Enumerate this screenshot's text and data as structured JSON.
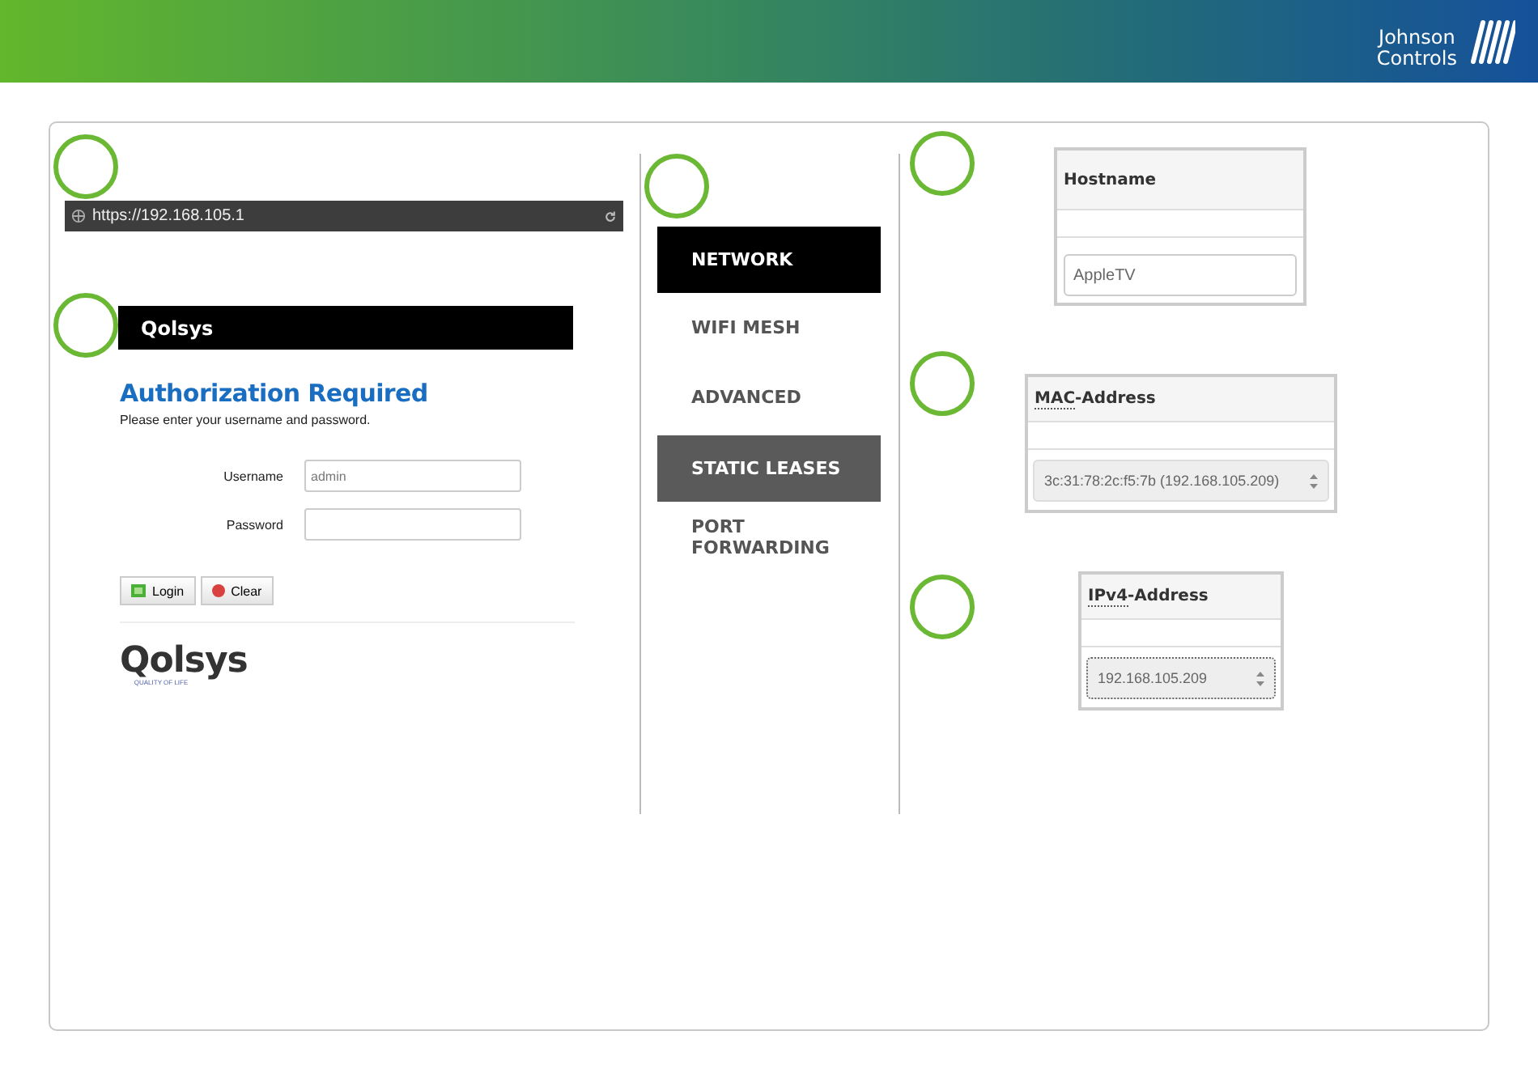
{
  "header": {
    "logo_lines": [
      "Johnson",
      "Controls"
    ]
  },
  "browser": {
    "url": "https://192.168.105.1"
  },
  "login": {
    "banner_logo": "Qolsys",
    "title": "Authorization Required",
    "subtitle": "Please enter your username and password.",
    "fields": [
      {
        "label": "Username",
        "value": "admin"
      },
      {
        "label": "Password"
      }
    ],
    "buttons": [
      {
        "label": "Login",
        "kind": "login"
      },
      {
        "label": "Clear",
        "kind": "clear"
      }
    ],
    "footer_logo": "Qolsys",
    "footer_tagline": "QUALITY OF LIFE"
  },
  "menu": [
    {
      "label": "NETWORK",
      "selected": true,
      "highlighted": false
    },
    {
      "label": "WIFI MESH",
      "selected": false,
      "highlighted": false
    },
    {
      "label": "ADVANCED",
      "selected": false,
      "highlighted": false
    },
    {
      "label": "STATIC LEASES",
      "selected": false,
      "highlighted": true
    },
    {
      "label": "PORT FORWARDING",
      "selected": false,
      "highlighted": false
    }
  ],
  "panels": [
    {
      "kind": "input",
      "header": "Hostname",
      "value": "AppleTV"
    },
    {
      "kind": "select",
      "header_abbr": "MAC",
      "header": "-Address",
      "value": "3c:31:78:2c:f5:7b (192.168.105.209)"
    },
    {
      "kind": "select",
      "header_abbr": "IPv4",
      "header": "-Address",
      "value": "192.168.105.209"
    }
  ]
}
